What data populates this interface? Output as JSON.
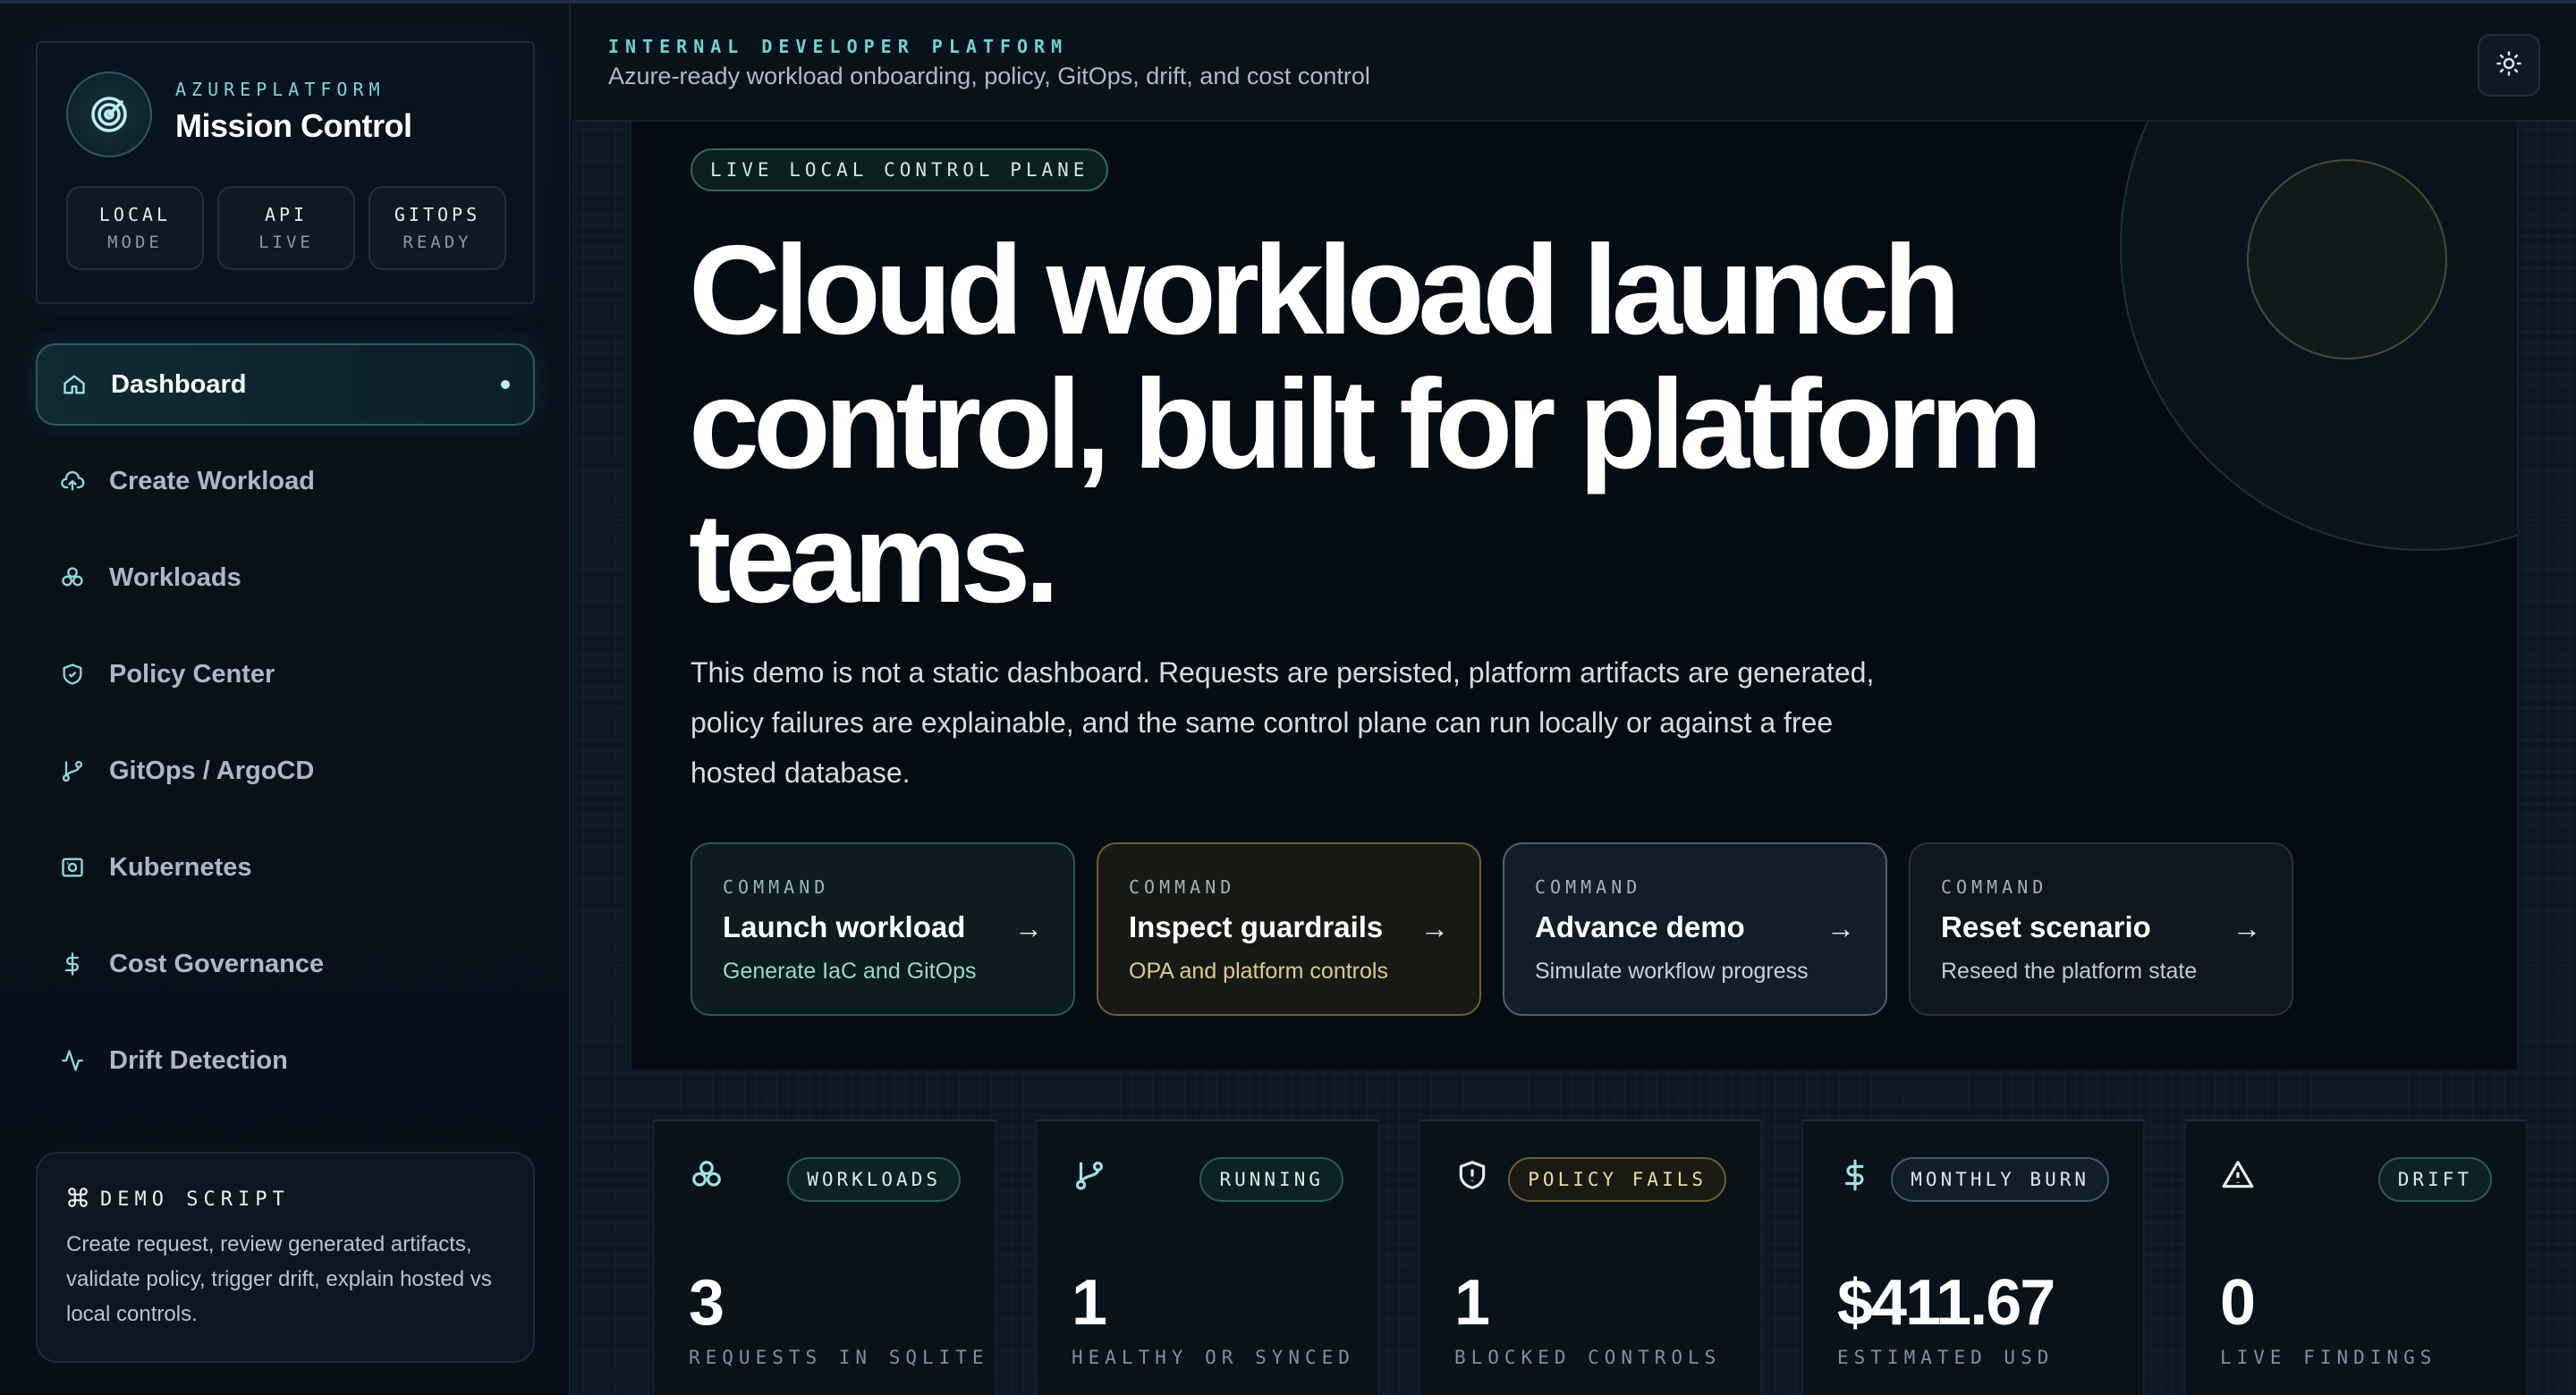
{
  "brand": {
    "subtitle": "AZUREPLATFORM",
    "title": "Mission Control",
    "pills": [
      {
        "l1": "LOCAL",
        "l2": "MODE"
      },
      {
        "l1": "API",
        "l2": "LIVE"
      },
      {
        "l1": "GITOPS",
        "l2": "READY"
      }
    ]
  },
  "nav": [
    {
      "label": "Dashboard",
      "icon": "home-icon",
      "active": true
    },
    {
      "label": "Create Workload",
      "icon": "cloud-upload-icon"
    },
    {
      "label": "Workloads",
      "icon": "boxes-icon"
    },
    {
      "label": "Policy Center",
      "icon": "shield-check-icon"
    },
    {
      "label": "GitOps / ArgoCD",
      "icon": "git-branch-icon"
    },
    {
      "label": "Kubernetes",
      "icon": "container-icon"
    },
    {
      "label": "Cost Governance",
      "icon": "dollar-icon"
    },
    {
      "label": "Drift Detection",
      "icon": "activity-icon"
    }
  ],
  "demo_script": {
    "title": "DEMO SCRIPT",
    "body": "Create request, review generated artifacts, validate policy, trigger drift, explain hosted vs local controls."
  },
  "header": {
    "kicker": "INTERNAL DEVELOPER PLATFORM",
    "subtitle": "Azure-ready workload onboarding, policy, GitOps, drift, and cost control"
  },
  "hero": {
    "pill": "LIVE LOCAL CONTROL PLANE",
    "title_l1": "Cloud workload launch",
    "title_l2": "control, built for platform",
    "title_l3": "teams.",
    "desc_l1": "This demo is not a static dashboard. Requests are persisted, platform artifacts are generated,",
    "desc_l2": "policy failures are explainable, and the same control plane can run locally or against a free",
    "desc_l3": "hosted database."
  },
  "commands": [
    {
      "kicker": "COMMAND",
      "title": "Launch workload",
      "sub": "Generate IaC and GitOps"
    },
    {
      "kicker": "COMMAND",
      "title": "Inspect guardrails",
      "sub": "OPA and platform controls"
    },
    {
      "kicker": "COMMAND",
      "title": "Advance demo",
      "sub": "Simulate workflow progress"
    },
    {
      "kicker": "COMMAND",
      "title": "Reset scenario",
      "sub": "Reseed the platform state"
    }
  ],
  "stats": [
    {
      "badge": "WORKLOADS",
      "value": "3",
      "label": "REQUESTS IN SQLITE",
      "icon": "boxes-icon"
    },
    {
      "badge": "RUNNING",
      "value": "1",
      "label": "HEALTHY OR SYNCED",
      "icon": "git-branch-icon"
    },
    {
      "badge": "POLICY FAILS",
      "value": "1",
      "label": "BLOCKED CONTROLS",
      "icon": "shield-alert-icon"
    },
    {
      "badge": "MONTHLY BURN",
      "value": "$411.67",
      "label": "ESTIMATED USD",
      "icon": "dollar-icon"
    },
    {
      "badge": "DRIFT",
      "value": "0",
      "label": "LIVE FINDINGS",
      "icon": "warning-icon"
    }
  ],
  "colors": {
    "accent": "#6fd2d6",
    "warn": "#e0c27a",
    "background": "#050b12"
  }
}
